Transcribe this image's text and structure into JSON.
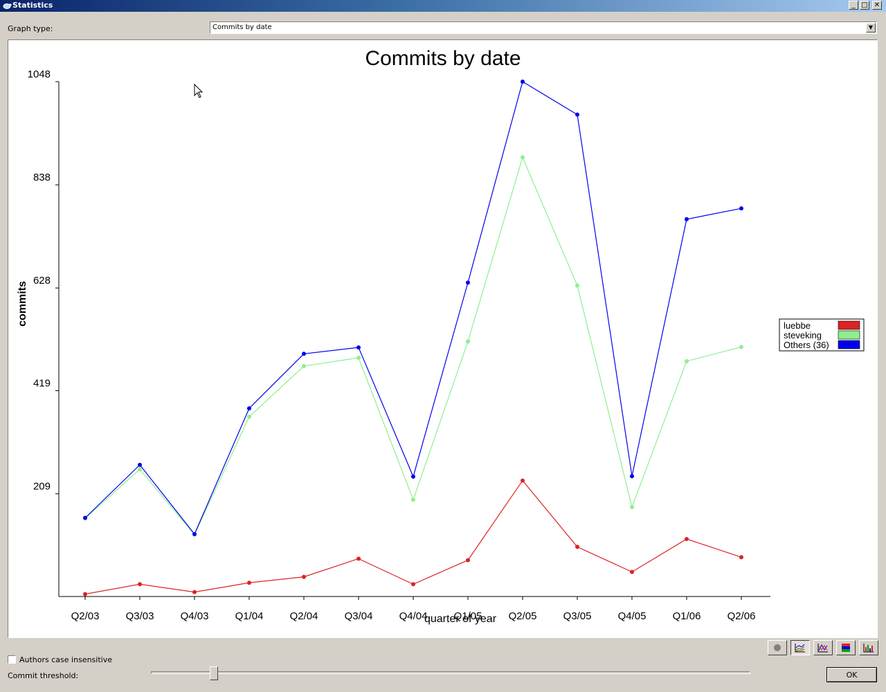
{
  "window": {
    "title": "Statistics",
    "minimize_glyph": "_",
    "maximize_glyph": "□",
    "close_glyph": "✕"
  },
  "graph_type": {
    "label": "Graph type:",
    "selected": "Commits by date"
  },
  "chart_data": {
    "type": "line",
    "title": "Commits by date",
    "xlabel": "quarter of year",
    "ylabel": "commits",
    "categories": [
      "Q2/03",
      "Q3/03",
      "Q4/03",
      "Q1/04",
      "Q2/04",
      "Q3/04",
      "Q4/04",
      "Q1/05",
      "Q2/05",
      "Q3/05",
      "Q4/05",
      "Q1/06",
      "Q2/06"
    ],
    "yticks": [
      209,
      419,
      628,
      838,
      1048
    ],
    "ylim": [
      0,
      1048
    ],
    "stacked": true,
    "legend_position": "right",
    "series": [
      {
        "name": "luebbe",
        "color": "#dd2222",
        "values": [
          5,
          25,
          9,
          28,
          40,
          77,
          25,
          74,
          236,
          101,
          50,
          117,
          80
        ]
      },
      {
        "name": "steveking",
        "color": "#90ee90",
        "values": [
          159,
          259,
          126,
          366,
          469,
          486,
          197,
          519,
          894,
          633,
          182,
          479,
          508
        ]
      },
      {
        "name": "Others (36)",
        "color": "#0000ee",
        "values": [
          160,
          268,
          127,
          383,
          494,
          507,
          244,
          639,
          1048,
          981,
          245,
          768,
          790
        ]
      }
    ]
  },
  "authors_case_insensitive": {
    "label": "Authors case insensitive",
    "checked": false
  },
  "commit_threshold": {
    "label": "Commit threshold:",
    "value": 0.1
  },
  "ok_button": {
    "label": "OK"
  },
  "toolbar": {
    "icons": [
      "pie-chart-icon",
      "stacked-line-chart-icon",
      "line-chart-icon",
      "stacked-bar-chart-icon",
      "bar-chart-icon"
    ],
    "active": "stacked-line-chart-icon"
  }
}
